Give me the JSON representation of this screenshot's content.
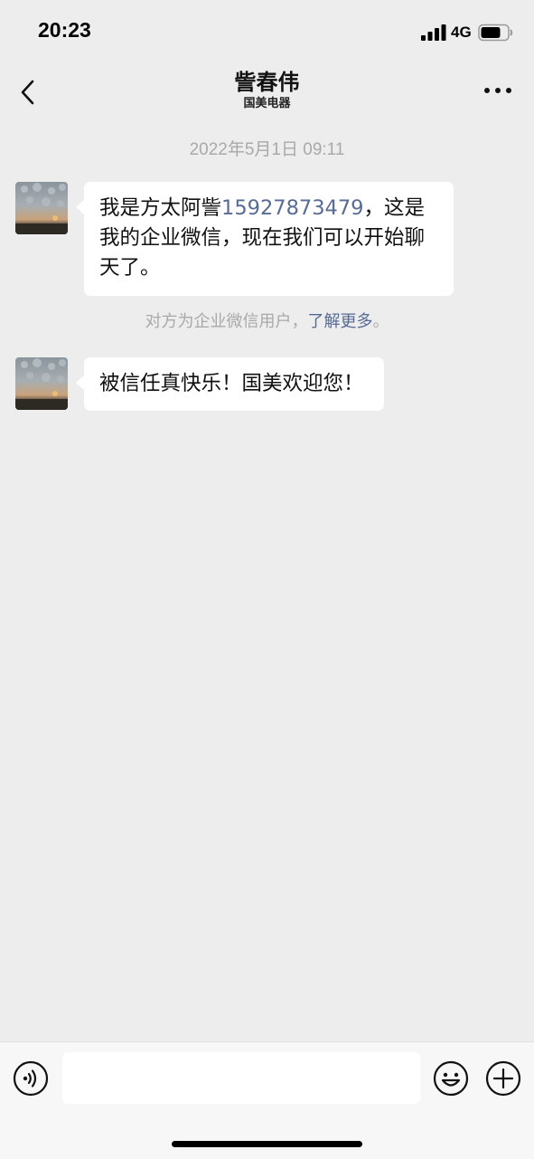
{
  "status_bar": {
    "time": "20:23",
    "network": "4G",
    "battery_level": 0.75
  },
  "nav": {
    "title": "訾春伟",
    "subtitle": "国美电器",
    "back_icon": "chevron-left-icon",
    "more_icon": "more-dots-icon"
  },
  "chat": {
    "timestamp": "2022年5月1日 09:11",
    "messages": [
      {
        "sender": "contact",
        "text_before": "我是方太阿訾",
        "phone": "15927873479",
        "text_after": "，这是我的企业微信，现在我们可以开始聊天了。"
      },
      {
        "sender": "contact",
        "text": "被信任真快乐！国美欢迎您！"
      }
    ],
    "system_note": {
      "text": "对方为企业微信用户，",
      "link": "了解更多",
      "suffix": "。"
    }
  },
  "input_bar": {
    "placeholder": "",
    "voice_icon": "voice-icon",
    "emoji_icon": "emoji-icon",
    "plus_icon": "plus-icon"
  },
  "colors": {
    "background": "#ededed",
    "bubble": "#ffffff",
    "link": "#576b95",
    "muted_text": "#a9a9a9"
  }
}
